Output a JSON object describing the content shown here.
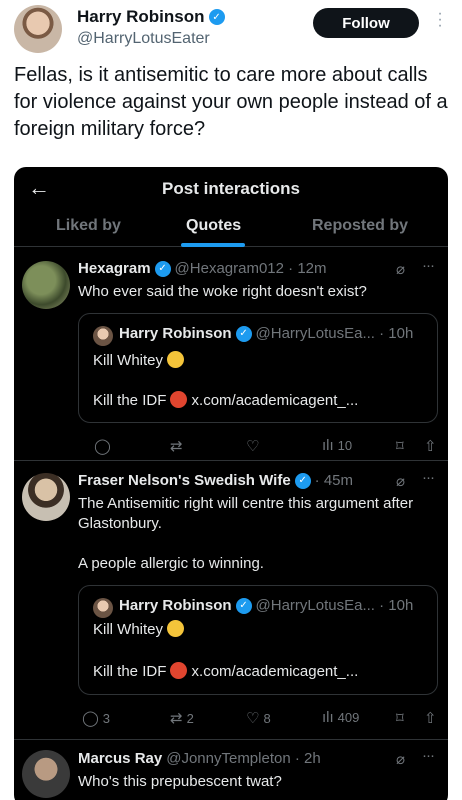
{
  "post": {
    "author_name": "Harry Robinson",
    "author_handle": "@HarryLotusEater",
    "follow_label": "Follow",
    "text": "Fellas, is it antisemitic to care more about calls for violence against your own people instead of a foreign military force?"
  },
  "embedded": {
    "title": "Post interactions",
    "back_icon": "←",
    "tabs": [
      {
        "label": "Liked by"
      },
      {
        "label": "Quotes",
        "active": true
      },
      {
        "label": "Reposted by"
      }
    ],
    "accent_color": "#1d9bf0",
    "quotes": [
      {
        "name": "Hexagram",
        "meta": "@Hexagram012 · 12m",
        "text": "Who ever said the woke right doesn't exist?",
        "quoted": {
          "name": "Harry Robinson",
          "meta": "@HarryLotusEa... · 10h",
          "line1": "Kill Whitey",
          "line2_prefix": "Kill the IDF",
          "line2_link": "x.com/academicagent_..."
        },
        "stats": {
          "replies": "",
          "reposts": "",
          "likes": "",
          "views": "10"
        }
      },
      {
        "name": "Fraser Nelson's Swedish Wife",
        "meta": "· 45m",
        "text_lines": [
          "The Antisemitic right will centre this argument after Glastonbury.",
          "A people allergic to winning."
        ],
        "quoted": {
          "name": "Harry Robinson",
          "meta": "@HarryLotusEa... · 10h",
          "line1": "Kill Whitey",
          "line2_prefix": "Kill the IDF",
          "line2_link": "x.com/academicagent_..."
        },
        "stats": {
          "replies": "3",
          "reposts": "2",
          "likes": "8",
          "views": "409"
        }
      },
      {
        "name": "Marcus Ray",
        "meta": "@JonnyTempleton · 2h",
        "text": "Who's this prepubescent twat?"
      }
    ]
  }
}
